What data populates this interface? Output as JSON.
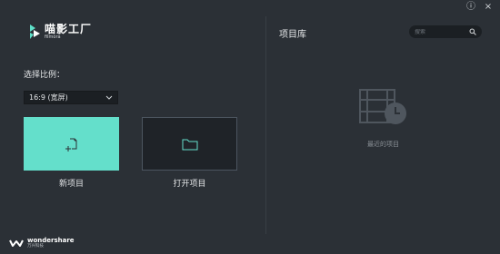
{
  "app": {
    "logo_cn": "喵影工厂",
    "logo_en": "filmora"
  },
  "titlebar": {
    "info_glyph": "ⓘ",
    "close_glyph": "×"
  },
  "left": {
    "ratio_label": "选择比例：",
    "ratio_selected": "16:9 (宽屏)",
    "new_project_label": "新项目",
    "open_project_label": "打开项目"
  },
  "right": {
    "library_title": "项目库",
    "search_placeholder": "搜索",
    "empty_text": "最近的项目"
  },
  "footer": {
    "brand_en": "wondershare",
    "brand_cn": "万兴科技"
  },
  "colors": {
    "background": "#2b3036",
    "accent": "#64dfcb"
  }
}
